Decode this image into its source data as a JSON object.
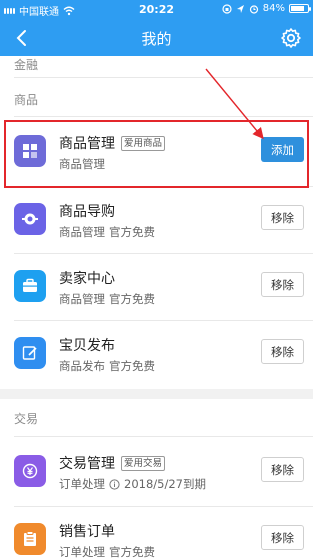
{
  "status_bar": {
    "carrier": "中国联通",
    "time": "20:22",
    "battery": "84%",
    "battery_level": 0.84
  },
  "nav": {
    "title": "我的",
    "back_icon": "chevron-left-icon",
    "settings_icon": "gear-icon"
  },
  "sections": {
    "finance": "金融",
    "goods": "商品",
    "trade": "交易"
  },
  "items": [
    {
      "name": "商品管理",
      "tag": "爱用商品",
      "sub1": "商品管理",
      "sub2": "",
      "button": "添加",
      "icon": "grid-icon",
      "color": "#6e6bd8"
    },
    {
      "name": "商品导购",
      "tag": "",
      "sub1": "商品管理",
      "sub2": "官方免费",
      "button": "移除",
      "icon": "guide-icon",
      "color": "#6b63e6"
    },
    {
      "name": "卖家中心",
      "tag": "",
      "sub1": "商品管理",
      "sub2": "官方免费",
      "button": "移除",
      "icon": "briefcase-icon",
      "color": "#1ea0f0"
    },
    {
      "name": "宝贝发布",
      "tag": "",
      "sub1": "商品发布",
      "sub2": "官方免费",
      "button": "移除",
      "icon": "edit-icon",
      "color": "#2f8ef0"
    },
    {
      "name": "交易管理",
      "tag": "爱用交易",
      "sub1": "订单处理",
      "sub2": "2018/5/27到期",
      "button": "移除",
      "icon": "yen-icon",
      "color": "#8a5ce6"
    },
    {
      "name": "销售订单",
      "tag": "",
      "sub1": "订单处理",
      "sub2": "官方免费",
      "button": "移除",
      "icon": "order-icon",
      "color": "#f08a2c"
    }
  ]
}
